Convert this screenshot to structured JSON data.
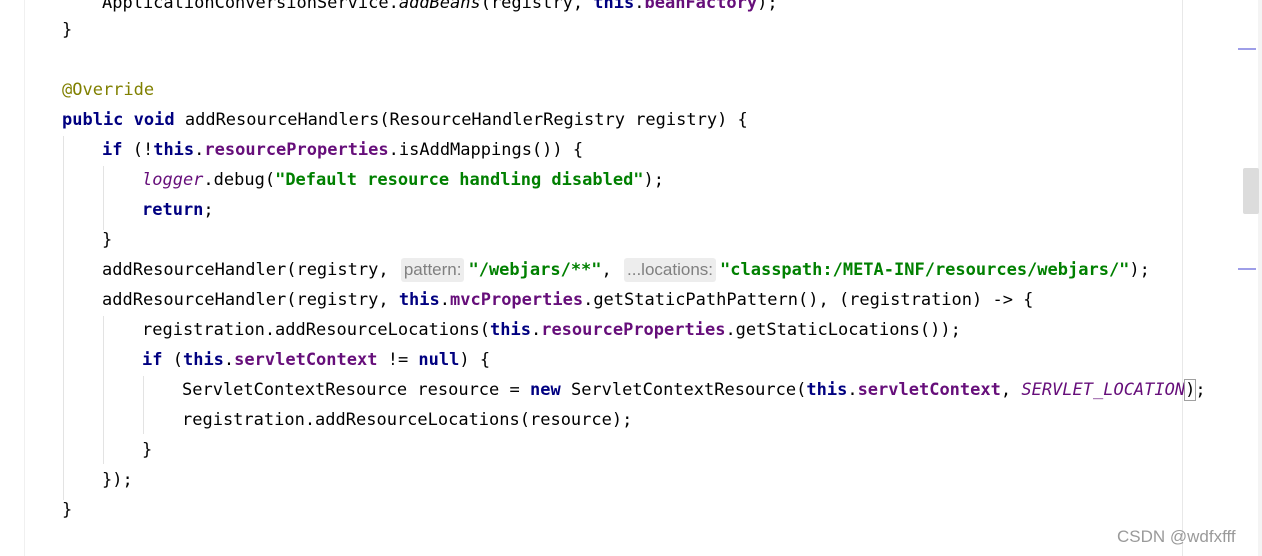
{
  "editor": {
    "lines": {
      "l0": {
        "a": "ApplicationConversionService.",
        "b": "addBeans",
        "c": "(registry, ",
        "d": "this",
        "e": ".",
        "f": "beanFactory",
        "g": ");"
      },
      "l1": {
        "a": "}"
      },
      "l3": {
        "a": "@Override"
      },
      "l4": {
        "a": "public",
        "b": " ",
        "c": "void",
        "d": " addResourceHandlers(ResourceHandlerRegistry registry) {"
      },
      "l5": {
        "a": "if",
        "b": " (!",
        "c": "this",
        "d": ".",
        "e": "resourceProperties",
        "f": ".isAddMappings()) {"
      },
      "l6": {
        "a": "logger",
        "b": ".debug(",
        "c": "\"Default resource handling disabled\"",
        "d": ");"
      },
      "l7": {
        "a": "return",
        "b": ";"
      },
      "l8": {
        "a": "}"
      },
      "l9": {
        "a": "addResourceHandler(registry, ",
        "hint1": "pattern:",
        "b": "\"/webjars/**\"",
        "c": ", ",
        "hint2": "...locations:",
        "d": "\"classpath:/META-INF/resources/webjars/\"",
        "e": ");"
      },
      "l10": {
        "a": "addResourceHandler(registry, ",
        "b": "this",
        "c": ".",
        "d": "mvcProperties",
        "e": ".getStaticPathPattern(), (registration) -> {"
      },
      "l11": {
        "a": "registration.addResourceLocations(",
        "b": "this",
        "c": ".",
        "d": "resourceProperties",
        "e": ".getStaticLocations());"
      },
      "l12": {
        "a": "if",
        "b": " (",
        "c": "this",
        "d": ".",
        "e": "servletContext",
        "f": " != ",
        "g": "null",
        "h": ") {"
      },
      "l13": {
        "a": "ServletContextResource resource = ",
        "b": "new",
        "c": " ServletContextResource(",
        "d": "this",
        "e": ".",
        "f": "servletContext",
        "g": ", ",
        "h": "SERVLET_LOCATION",
        "i": ")",
        "j": ";"
      },
      "l14": {
        "a": "registration.addResourceLocations(resource);"
      },
      "l15": {
        "a": "}"
      },
      "l16": {
        "a": "});"
      },
      "l17": {
        "a": "}"
      }
    },
    "colors": {
      "keyword": "#000080",
      "field": "#660e7a",
      "string": "#008000",
      "annotation": "#808000",
      "hint_bg": "#ededed"
    }
  },
  "watermark": "CSDN @wdfxfff"
}
